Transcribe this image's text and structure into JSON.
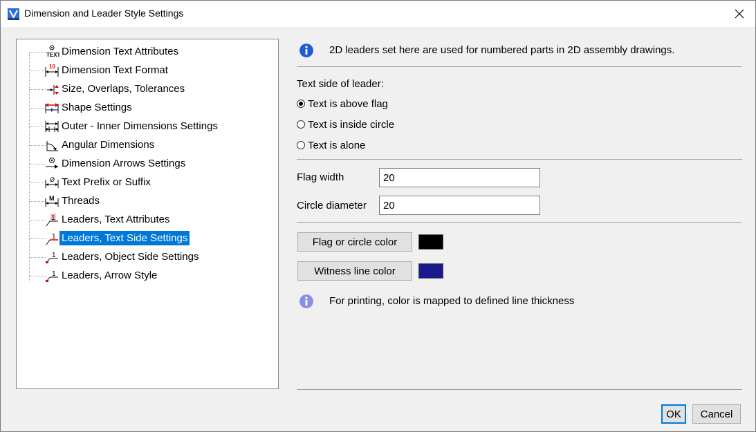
{
  "window": {
    "title": "Dimension and Leader Style Settings",
    "close_glyph": "✕"
  },
  "tree": {
    "items": [
      {
        "label": "Dimension Text Attributes",
        "icon": "dimension-text-attributes-icon"
      },
      {
        "label": "Dimension Text Format",
        "icon": "dimension-text-format-icon"
      },
      {
        "label": "Size, Overlaps, Tolerances",
        "icon": "size-overlaps-icon"
      },
      {
        "label": "Shape Settings",
        "icon": "shape-settings-icon"
      },
      {
        "label": "Outer - Inner Dimensions Settings",
        "icon": "outer-inner-dimensions-icon"
      },
      {
        "label": "Angular Dimensions",
        "icon": "angular-dimensions-icon"
      },
      {
        "label": "Dimension Arrows Settings",
        "icon": "dimension-arrows-icon"
      },
      {
        "label": "Text Prefix or Suffix",
        "icon": "text-prefix-suffix-icon"
      },
      {
        "label": "Threads",
        "icon": "threads-icon"
      },
      {
        "label": "Leaders, Text Attributes",
        "icon": "leader-text-attributes-icon"
      },
      {
        "label": "Leaders, Text Side Settings",
        "icon": "leader-text-side-icon",
        "selected": true
      },
      {
        "label": "Leaders, Object Side Settings",
        "icon": "leader-object-side-icon"
      },
      {
        "label": "Leaders, Arrow Style",
        "icon": "leader-arrow-style-icon"
      }
    ]
  },
  "panel": {
    "info_top": "2D leaders set here are used for numbered parts in 2D assembly drawings.",
    "text_side_label": "Text side of leader:",
    "radios": [
      {
        "label": "Text is above flag",
        "checked": true
      },
      {
        "label": "Text is inside circle",
        "checked": false
      },
      {
        "label": "Text is alone",
        "checked": false
      }
    ],
    "flag_width_label": "Flag width",
    "flag_width_value": "20",
    "circle_diameter_label": "Circle diameter",
    "circle_diameter_value": "20",
    "flag_color_button": "Flag or circle color",
    "flag_color": "#000000",
    "witness_color_button": "Witness line color",
    "witness_color": "#1a1a8c",
    "info_bottom": "For printing, color is mapped to defined line thickness"
  },
  "footer": {
    "ok_label": "OK",
    "cancel_label": "Cancel"
  },
  "colors": {
    "selection": "#0078d7",
    "info_icon_primary": "#1e5bd6",
    "info_icon_secondary": "#8a8ee6"
  }
}
